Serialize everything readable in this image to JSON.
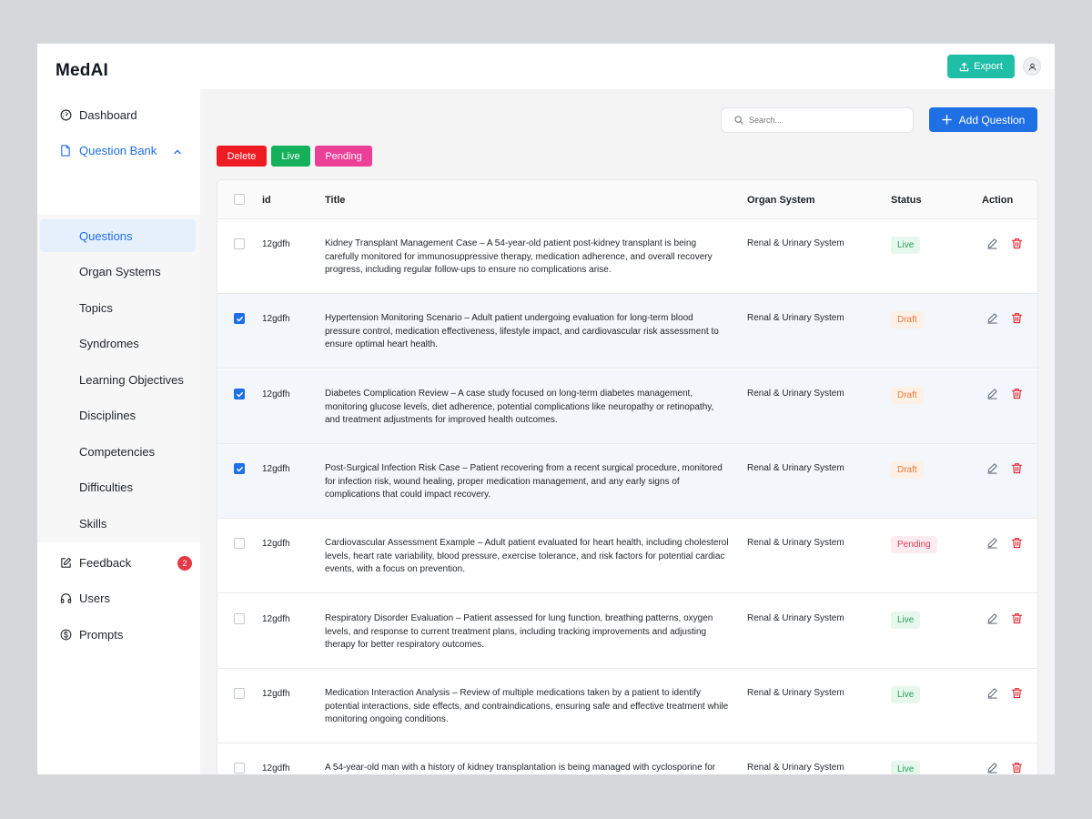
{
  "app": {
    "title": "MedAI"
  },
  "topbar": {
    "export_label": "Export"
  },
  "sidebar": {
    "items": [
      {
        "label": "Dashboard",
        "icon": "dashboard-icon"
      },
      {
        "label": "Question Bank",
        "icon": "document-icon"
      },
      {
        "label": "Feedback",
        "icon": "edit-note-icon",
        "badge": "2"
      },
      {
        "label": "Users",
        "icon": "headphones-icon"
      },
      {
        "label": "Prompts",
        "icon": "dollar-icon"
      }
    ],
    "question_bank_children": [
      "Questions",
      "Organ Systems",
      "Topics",
      "Syndromes",
      "Learning Objectives",
      "Disciplines",
      "Competencies",
      "Difficulties",
      "Skills"
    ],
    "selected_child": "Questions"
  },
  "toolbar": {
    "search_placeholder": "Search...",
    "add_label": "Add Question",
    "chips": [
      "Delete",
      "Live",
      "Pending"
    ]
  },
  "table": {
    "headers": [
      "id",
      "Title",
      "Organ System",
      "Status",
      "Action"
    ],
    "rows": [
      {
        "id": "12gdfh",
        "checked": false,
        "title": "Kidney Transplant Management Case – A 54-year-old patient post-kidney transplant is being carefully monitored for immunosuppressive therapy, medication adherence, and overall recovery progress, including regular follow-ups to ensure no complications arise.",
        "organ": "Renal & Urinary System",
        "status": "Live"
      },
      {
        "id": "12gdfh",
        "checked": true,
        "title": "Hypertension Monitoring Scenario – Adult patient undergoing evaluation for long-term blood pressure control, medication effectiveness, lifestyle impact, and cardiovascular risk assessment to ensure optimal heart health.",
        "organ": "Renal & Urinary System",
        "status": "Draft"
      },
      {
        "id": "12gdfh",
        "checked": true,
        "title": "Diabetes Complication Review – A case study focused on long-term diabetes management, monitoring glucose levels, diet adherence, potential complications like neuropathy or retinopathy, and treatment adjustments for improved health outcomes.",
        "organ": "Renal & Urinary System",
        "status": "Draft"
      },
      {
        "id": "12gdfh",
        "checked": true,
        "title": "Post-Surgical Infection Risk Case – Patient recovering from a recent surgical procedure, monitored for infection risk, wound healing, proper medication management, and any early signs of complications that could impact recovery.",
        "organ": "Renal & Urinary System",
        "status": "Draft"
      },
      {
        "id": "12gdfh",
        "checked": false,
        "title": "Cardiovascular Assessment Example – Adult patient evaluated for heart health, including cholesterol levels, heart rate variability, blood pressure, exercise tolerance, and risk factors for potential cardiac events, with a focus on prevention.",
        "organ": "Renal & Urinary System",
        "status": "Pending"
      },
      {
        "id": "12gdfh",
        "checked": false,
        "title": "Respiratory Disorder Evaluation – Patient assessed for lung function, breathing patterns, oxygen levels, and response to current treatment plans, including tracking improvements and adjusting therapy for better respiratory outcomes.",
        "organ": "Renal & Urinary System",
        "status": "Live"
      },
      {
        "id": "12gdfh",
        "checked": false,
        "title": "Medication Interaction Analysis – Review of multiple medications taken by a patient to identify potential interactions, side effects, and contraindications, ensuring safe and effective treatment while monitoring ongoing conditions.",
        "organ": "Renal & Urinary System",
        "status": "Live"
      },
      {
        "id": "12gdfh",
        "checked": false,
        "title": "A 54-year-old man with a history of kidney transplantation is being managed with cyclosporine for",
        "organ": "Renal & Urinary System",
        "status": "Live"
      }
    ]
  },
  "colors": {
    "accent": "#1f6fe5",
    "export": "#1ebfa6",
    "delete_chip": "#ef1b22",
    "live_chip": "#14b05a",
    "pending_chip": "#ec3f97"
  }
}
